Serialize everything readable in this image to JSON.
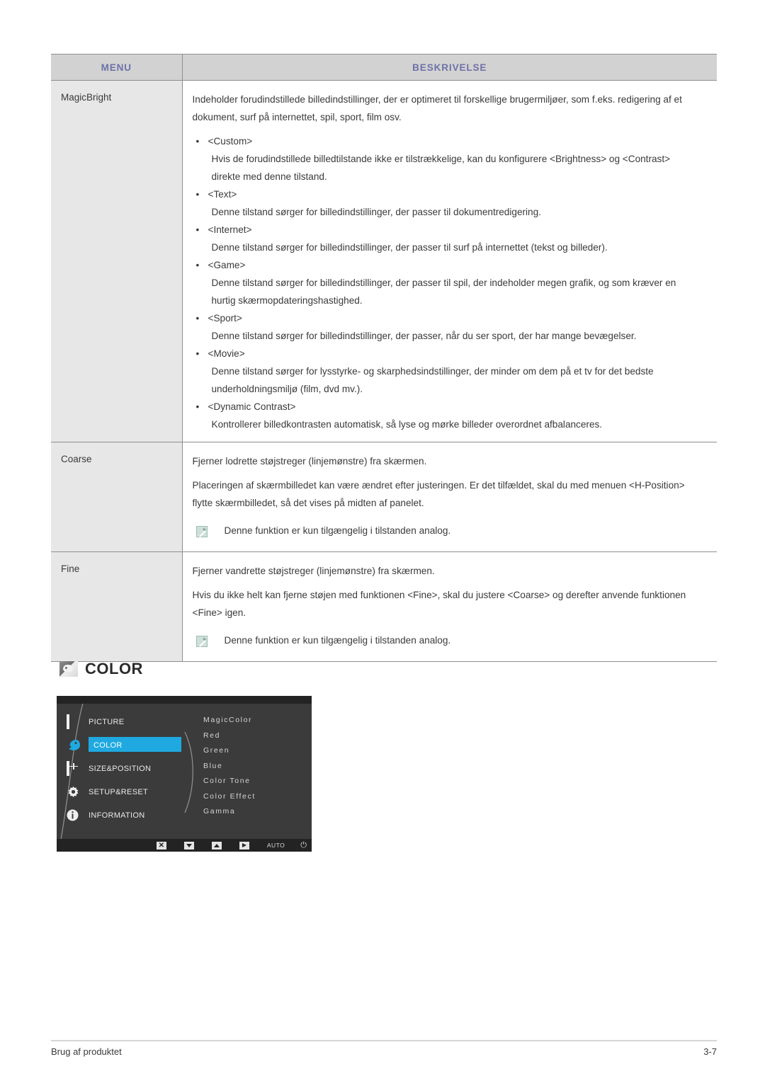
{
  "table": {
    "headers": {
      "menu": "MENU",
      "description": "BESKRIVELSE"
    },
    "rows": [
      {
        "menu": "MagicBright",
        "intro": "Indeholder forudindstillede billedindstillinger, der er optimeret til forskellige brugermiljøer, som f.eks. redigering af et dokument, surf på internettet, spil, sport, film osv.",
        "bullets": [
          {
            "label": "<Custom>",
            "body": "Hvis de forudindstillede billedtilstande ikke er tilstrækkelige, kan du konfigurere <Brightness> og <Contrast> direkte med denne tilstand."
          },
          {
            "label": "<Text>",
            "body": "Denne tilstand sørger for billedindstillinger, der passer til dokumentredigering."
          },
          {
            "label": "<Internet>",
            "body": "Denne tilstand sørger for billedindstillinger, der passer til surf på internettet (tekst og billeder)."
          },
          {
            "label": "<Game>",
            "body": "Denne tilstand sørger for billedindstillinger, der passer til spil, der indeholder megen grafik, og som kræver en hurtig skærmopdateringshastighed."
          },
          {
            "label": "<Sport>",
            "body": "Denne tilstand sørger for billedindstillinger, der passer, når du ser sport, der har mange bevægelser."
          },
          {
            "label": "<Movie>",
            "body": "Denne tilstand sørger for lysstyrke- og skarphedsindstillinger, der minder om dem på et tv for det bedste underholdningsmiljø (film, dvd mv.)."
          },
          {
            "label": "<Dynamic Contrast>",
            "body": "Kontrollerer billedkontrasten automatisk, så lyse og mørke billeder overordnet afbalanceres."
          }
        ]
      },
      {
        "menu": "Coarse",
        "paragraphs": [
          "Fjerner lodrette støjstreger (linjemønstre) fra skærmen.",
          "Placeringen af skærmbilledet kan være ændret efter justeringen. Er det tilfældet, skal du med menuen <H-Position> flytte skærmbilledet, så det vises på midten af panelet."
        ],
        "note": "Denne funktion er kun tilgængelig i tilstanden analog."
      },
      {
        "menu": "Fine",
        "paragraphs": [
          "Fjerner vandrette støjstreger (linjemønstre) fra skærmen.",
          "Hvis du ikke helt kan fjerne støjen med funktionen <Fine>, skal du justere <Coarse> og derefter anvende funktionen <Fine> igen."
        ],
        "note": "Denne funktion er kun tilgængelig i tilstanden analog."
      }
    ],
    "bullet_glyph": "•"
  },
  "section": {
    "heading": "COLOR",
    "icon": "color-palette-icon"
  },
  "osd": {
    "left_menu": [
      {
        "label": "PICTURE",
        "icon": "picture-icon",
        "selected": false
      },
      {
        "label": "COLOR",
        "icon": "color-palette-icon",
        "selected": true
      },
      {
        "label": "SIZE&POSITION",
        "icon": "size-position-icon",
        "selected": false
      },
      {
        "label": "SETUP&RESET",
        "icon": "gear-icon",
        "selected": false
      },
      {
        "label": "INFORMATION",
        "icon": "info-icon",
        "selected": false
      }
    ],
    "submenu": [
      "MagicColor",
      "Red",
      "Green",
      "Blue",
      "Color Tone",
      "Color Effect",
      "Gamma"
    ],
    "buttons": [
      {
        "name": "exit-button",
        "glyph": "✕"
      },
      {
        "name": "down-button",
        "glyph": "▼"
      },
      {
        "name": "up-button",
        "glyph": "▲"
      },
      {
        "name": "enter-button",
        "glyph": "▶"
      },
      {
        "name": "auto-button",
        "glyph": "AUTO"
      },
      {
        "name": "power-button",
        "glyph": "⏻"
      }
    ],
    "highlight_color": "#1fa9e0",
    "background_color": "#3b3b3b"
  },
  "footer": {
    "left": "Brug af produktet",
    "right": "3-7"
  }
}
